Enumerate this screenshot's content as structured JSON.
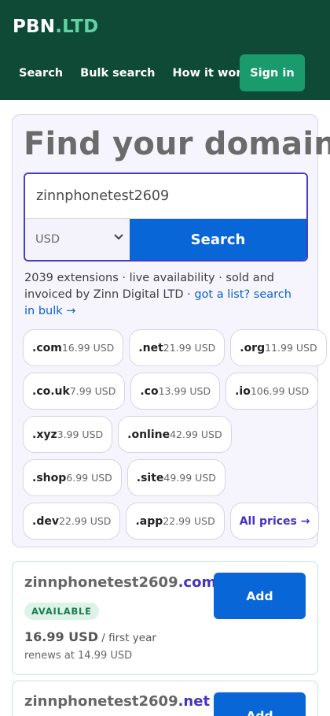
{
  "header": {
    "logo_main": "PBN",
    "logo_tld": ".LTD",
    "nav": [
      "Search",
      "Bulk search",
      "How it works"
    ],
    "signin_label": "Sign in"
  },
  "search_card": {
    "title": "Find your domain",
    "query_value": "zinnphonetest2609",
    "currency_selected": "USD",
    "search_label": "Search",
    "info_text": "2039 extensions · live availability · sold and invoiced by Zinn Digital LTD · ",
    "info_link": "got a list? search in bulk →",
    "chips": [
      {
        "ext": ".com",
        "price": "16.99 USD"
      },
      {
        "ext": ".net",
        "price": "21.99 USD"
      },
      {
        "ext": ".org",
        "price": "11.99 USD"
      },
      {
        "ext": ".co.uk",
        "price": "7.99 USD"
      },
      {
        "ext": ".co",
        "price": "13.99 USD"
      },
      {
        "ext": ".io",
        "price": "106.99 USD"
      },
      {
        "ext": ".xyz",
        "price": "3.99 USD"
      },
      {
        "ext": ".online",
        "price": "42.99 USD"
      },
      {
        "ext": ".shop",
        "price": "6.99 USD"
      },
      {
        "ext": ".site",
        "price": "49.99 USD"
      },
      {
        "ext": ".dev",
        "price": "22.99 USD"
      },
      {
        "ext": ".app",
        "price": "22.99 USD"
      }
    ],
    "all_prices_label": "All prices →"
  },
  "results": [
    {
      "name": "zinnphonetest2609",
      "ext": ".com",
      "status": "AVAILABLE",
      "price": "16.99 USD",
      "period": " / first year",
      "renews": "renews at 14.99 USD",
      "add_label": "Add"
    },
    {
      "name": "zinnphonetest2609",
      "ext": ".net",
      "add_label": "Add"
    }
  ],
  "colors": {
    "header_bg": "#0e4a36",
    "accent_green": "#1a9b6b",
    "primary_blue": "#0866d6",
    "purple": "#4433c2"
  }
}
